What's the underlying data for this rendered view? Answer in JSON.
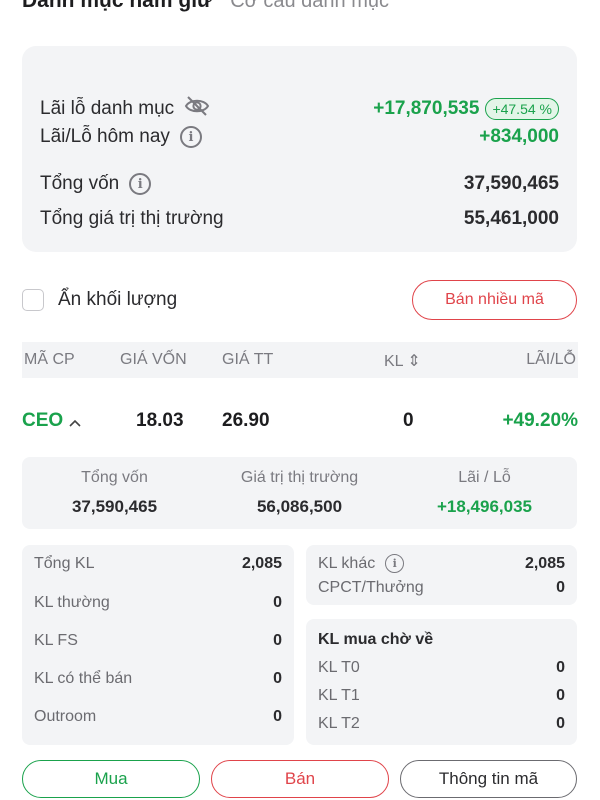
{
  "tabs": {
    "active": "Danh mục nắm giữ",
    "inactive": "Cơ cấu danh mục"
  },
  "summary": {
    "pnl_label": "Lãi lỗ danh mục",
    "pnl_value": "+17,870,535",
    "pnl_pct": "+47.54 %",
    "today_label": "Lãi/Lỗ hôm nay",
    "today_value": "+834,000",
    "capital_label": "Tổng vốn",
    "capital_value": "37,590,465",
    "market_label": "Tổng giá trị thị trường",
    "market_value": "55,461,000"
  },
  "options": {
    "hide_volume_label": "Ẩn khối lượng",
    "sell_many_label": "Bán nhiều mã"
  },
  "table": {
    "headers": [
      "MÃ CP",
      "GIÁ VỐN",
      "GIÁ TT",
      "KL ⇕",
      "LÃI/LỖ"
    ],
    "row": {
      "ticker": "CEO",
      "cost": "18.03",
      "price": "26.90",
      "qty": "0",
      "pnl": "+49.20%"
    }
  },
  "detail": {
    "capital_label": "Tổng vốn",
    "capital_value": "37,590,465",
    "market_label": "Giá trị thị trường",
    "market_value": "56,086,500",
    "pnl_label": "Lãi / Lỗ",
    "pnl_value": "+18,496,035"
  },
  "volume": {
    "left": [
      {
        "label": "Tổng KL",
        "value": "2,085"
      },
      {
        "label": "KL thường",
        "value": "0"
      },
      {
        "label": "KL FS",
        "value": "0"
      },
      {
        "label": "KL có thể bán",
        "value": "0"
      },
      {
        "label": "Outroom",
        "value": "0"
      }
    ],
    "right_top": [
      {
        "label": "KL khác",
        "value": "2,085"
      },
      {
        "label": "CPCT/Thưởng",
        "value": "0"
      }
    ],
    "pending_title": "KL mua chờ về",
    "pending": [
      {
        "label": "KL T0",
        "value": "0"
      },
      {
        "label": "KL T1",
        "value": "0"
      },
      {
        "label": "KL T2",
        "value": "0"
      }
    ]
  },
  "actions": {
    "buy": "Mua",
    "sell": "Bán",
    "info": "Thông tin mã"
  },
  "colors": {
    "green": "#1aa24c",
    "red": "#e0444a",
    "panel": "#f3f4f6"
  },
  "icons": {
    "hide": "eye-off-icon",
    "info": "info-icon",
    "expand": "chevron-up-icon"
  }
}
